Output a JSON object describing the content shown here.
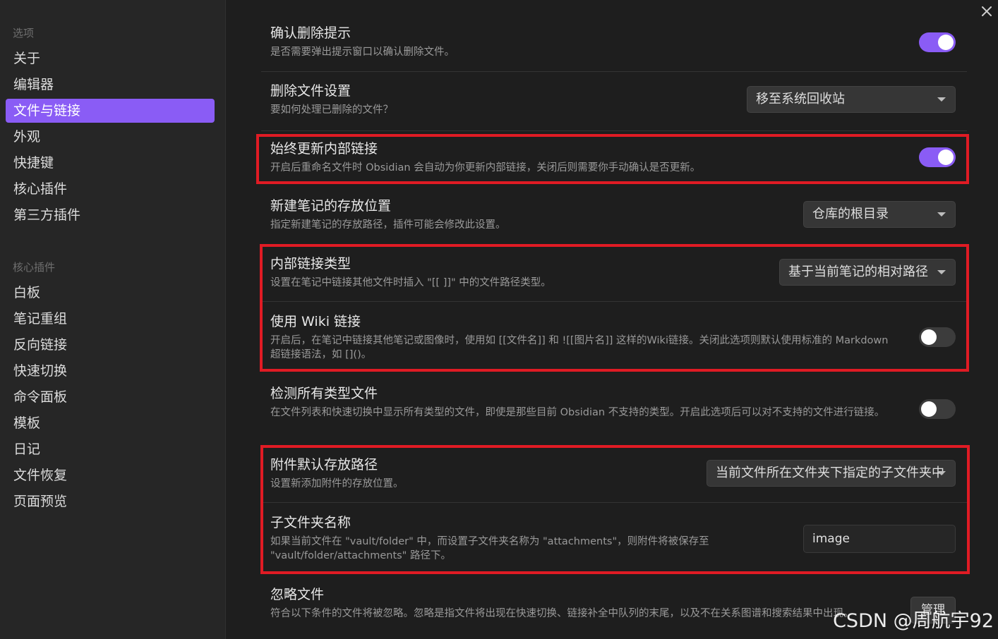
{
  "sidebar": {
    "group1_label": "选项",
    "items1": [
      "关于",
      "编辑器",
      "文件与链接",
      "外观",
      "快捷键",
      "核心插件",
      "第三方插件"
    ],
    "group2_label": "核心插件",
    "items2": [
      "白板",
      "笔记重组",
      "反向链接",
      "快速切换",
      "命令面板",
      "模板",
      "日记",
      "文件恢复",
      "页面预览"
    ],
    "active_item": "文件与链接"
  },
  "settings": {
    "confirm_delete": {
      "title": "确认删除提示",
      "desc": "是否需要弹出提示窗口以确认删除文件。",
      "enabled": true
    },
    "delete_files": {
      "title": "删除文件设置",
      "desc": "要如何处理已删除的文件？",
      "value": "移至系统回收站"
    },
    "always_update_links": {
      "title": "始终更新内部链接",
      "desc": "开启后重命名文件时 Obsidian 会自动为你更新内部链接，关闭后则需要你手动确认是否更新。",
      "enabled": true
    },
    "new_note_location": {
      "title": "新建笔记的存放位置",
      "desc": "指定新建笔记的存放路径，插件可能会修改此设置。",
      "value": "仓库的根目录"
    },
    "link_format": {
      "title": "内部链接类型",
      "desc": "设置在笔记中链接其他文件时插入 \"[[ ]]\" 中的文件路径类型。",
      "value": "基于当前笔记的相对路径"
    },
    "use_wiki_links": {
      "title": "使用 Wiki 链接",
      "desc": "开启后，在笔记中链接其他笔记或图像时，使用如 [[文件名]] 和 ![[图片名]] 这样的Wiki链接。关闭此选项则默认使用标准的 Markdown 超链接语法，如 []()。",
      "enabled": false
    },
    "detect_all_files": {
      "title": "检测所有类型文件",
      "desc": "在文件列表和快速切换中显示所有类型的文件，即使是那些目前 Obsidian 不支持的类型。开启此选项后可以对不支持的文件进行链接。",
      "enabled": false
    },
    "attachment_folder": {
      "title": "附件默认存放路径",
      "desc": "设置新添加附件的存放位置。",
      "value": "当前文件所在文件夹下指定的子文件夹中"
    },
    "subfolder_name": {
      "title": "子文件夹名称",
      "desc": "如果当前文件在 \"vault/folder\" 中，而设置子文件夹名称为 \"attachments\"，则附件将被保存至 \"vault/folder/attachments\" 路径下。",
      "value": "image"
    },
    "ignore_files": {
      "title": "忽略文件",
      "desc": "符合以下条件的文件将被忽略。忽略是指文件将出现在快速切换、链接补全中队列的末尾，以及不在关系图谱和搜索结果中出现。",
      "button": "管理"
    }
  },
  "watermark": "CSDN @周航宇92",
  "colors": {
    "accent": "#8a5cf5",
    "highlight": "#e01b24"
  }
}
